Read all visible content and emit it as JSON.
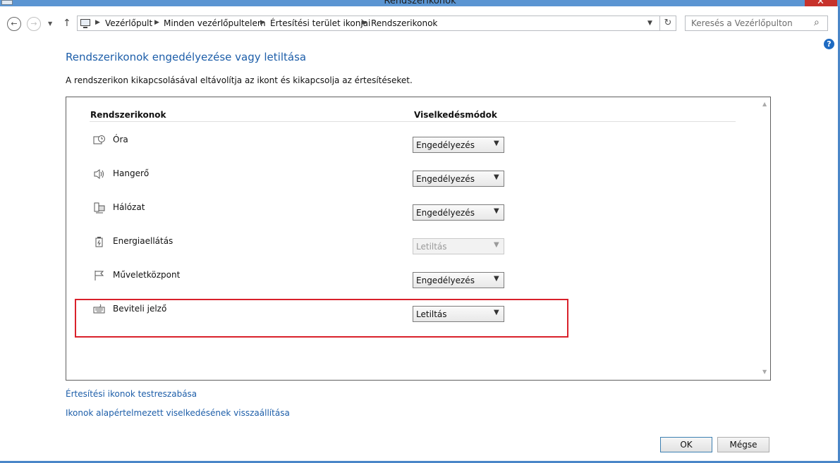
{
  "window": {
    "title": "Rendszerikonok"
  },
  "address": {
    "breadcrumbs": [
      "Vezérlőpult",
      "Minden vezérlőpultelem",
      "Értesítési terület ikonjai",
      "Rendszerikonok"
    ],
    "search_placeholder": "Keresés a Vezérlőpulton"
  },
  "page": {
    "heading": "Rendszerikonok engedélyezése vagy letiltása",
    "description": "A rendszerikon kikapcsolásával eltávolítja az ikont és kikapcsolja az értesítéseket."
  },
  "table": {
    "col_icons": "Rendszerikonok",
    "col_behaviors": "Viselkedésmódok",
    "rows": [
      {
        "label": "Óra",
        "value": "Engedélyezés",
        "icon": "clock-icon",
        "disabled": false
      },
      {
        "label": "Hangerő",
        "value": "Engedélyezés",
        "icon": "speaker-icon",
        "disabled": false
      },
      {
        "label": "Hálózat",
        "value": "Engedélyezés",
        "icon": "network-icon",
        "disabled": false
      },
      {
        "label": "Energiaellátás",
        "value": "Letiltás",
        "icon": "power-icon",
        "disabled": true
      },
      {
        "label": "Műveletközpont",
        "value": "Engedélyezés",
        "icon": "flag-icon",
        "disabled": false
      },
      {
        "label": "Beviteli jelző",
        "value": "Letiltás",
        "icon": "keyboard-icon",
        "disabled": false
      }
    ]
  },
  "links": {
    "customize": "Értesítési ikonok testreszabása",
    "restore": "Ikonok alapértelmezett viselkedésének visszaállítása"
  },
  "buttons": {
    "ok": "OK",
    "cancel": "Mégse"
  },
  "colors": {
    "accent": "#1d5ea9",
    "highlight": "#d9212b"
  }
}
